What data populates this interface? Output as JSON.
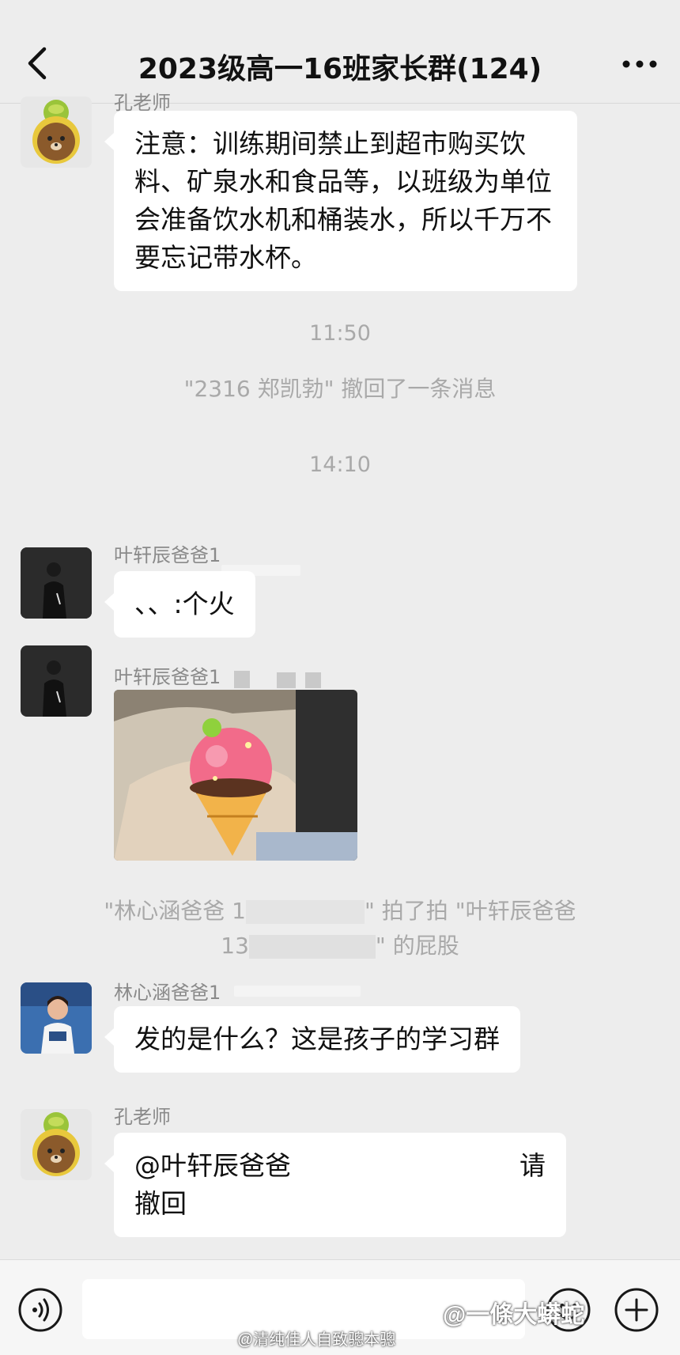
{
  "header": {
    "title": "2023级高一16班家长群(124)"
  },
  "messages": [
    {
      "sender": "孔老师",
      "text": "注意：训练期间禁止到超市购买饮料、矿泉水和食品等，以班级为单位会准备饮水机和桶装水，所以千万不要忘记带水杯。"
    },
    {
      "sender": "叶轩辰爸爸1",
      "text": "、、:个火"
    },
    {
      "sender": "叶轩辰爸爸1",
      "type": "image"
    },
    {
      "sender": "林心涵爸爸1",
      "text": "发的是什么？这是孩子的学习群"
    },
    {
      "sender": "孔老师",
      "text_line1_start": "@叶轩辰爸爸",
      "text_line1_end": "请",
      "text_line2": "撤回"
    }
  ],
  "system": {
    "time1": "11:50",
    "recall": "\"2316 郑凯勃\" 撤回了一条消息",
    "time2": "14:10",
    "pat_line1_a": "\"林心涵爸爸 1",
    "pat_line1_b": "\" 拍了拍 \"叶轩辰爸爸",
    "pat_line2_a": "13",
    "pat_line2_b": "\" 的屁股"
  },
  "watermarks": {
    "weibo": "@清纯佳人自致骢本骢",
    "corner": "@一條大蟒蛇"
  },
  "icons": {
    "back": "chevron-left-icon",
    "more": "more-dots-icon",
    "voice": "voice-icon",
    "emoji": "emoji-icon",
    "plus": "plus-icon"
  },
  "colors": {
    "background": "#ededed",
    "bubble": "#ffffff",
    "system_text": "#a9a9a9"
  }
}
